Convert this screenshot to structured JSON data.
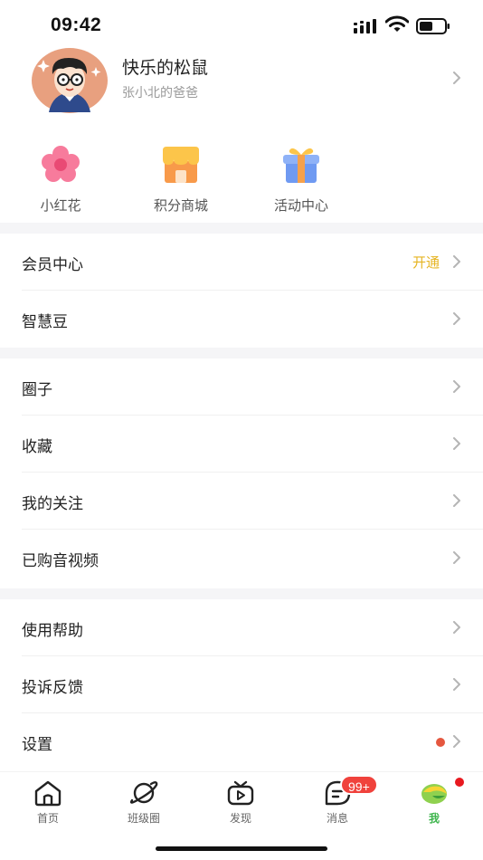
{
  "status": {
    "time": "09:42"
  },
  "profile": {
    "name": "快乐的松鼠",
    "subtitle": "张小北的爸爸"
  },
  "quick": [
    {
      "label": "小红花",
      "icon": "red-flower-icon"
    },
    {
      "label": "积分商城",
      "icon": "store-icon"
    },
    {
      "label": "活动中心",
      "icon": "gift-icon"
    }
  ],
  "menu": {
    "member": {
      "label": "会员中心",
      "action": "开通"
    },
    "beans": {
      "label": "智慧豆"
    },
    "circle": {
      "label": "圈子"
    },
    "favorites": {
      "label": "收藏"
    },
    "following": {
      "label": "我的关注"
    },
    "purchased": {
      "label": "已购音视频"
    },
    "help": {
      "label": "使用帮助"
    },
    "feedback": {
      "label": "投诉反馈"
    },
    "settings": {
      "label": "设置"
    }
  },
  "tabs": [
    {
      "label": "首页",
      "icon": "home-icon"
    },
    {
      "label": "班级圈",
      "icon": "planet-icon"
    },
    {
      "label": "发现",
      "icon": "tv-play-icon"
    },
    {
      "label": "消息",
      "icon": "message-icon",
      "badge": "99+"
    },
    {
      "label": "我",
      "icon": "avatar-icon",
      "active": true
    }
  ],
  "colors": {
    "accent_green": "#3cb44b",
    "badge_red": "#f0423c",
    "gold": "#e6b422"
  }
}
